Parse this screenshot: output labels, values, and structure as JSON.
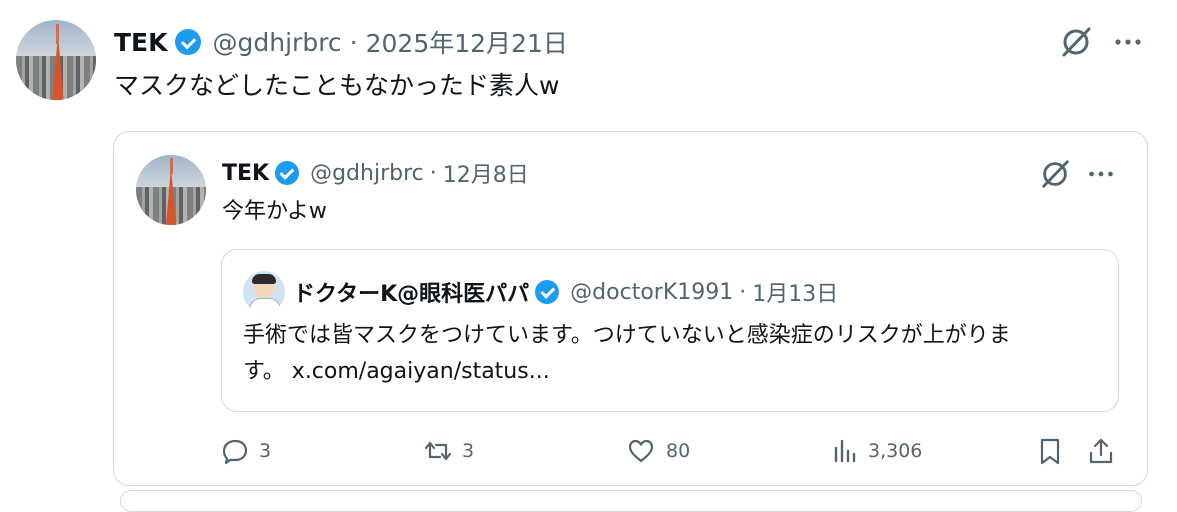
{
  "main_post": {
    "author_name": "TEK",
    "handle": "@gdhjrbrc",
    "separator": "·",
    "date": "2025年12月21日",
    "text": "マスクなどしたこともなかったド素人w"
  },
  "quoted_post": {
    "author_name": "TEK",
    "handle": "@gdhjrbrc",
    "separator": "·",
    "date": "12月8日",
    "text": "今年かよw",
    "stats": {
      "replies": "3",
      "reposts": "3",
      "likes": "80",
      "views": "3,306"
    }
  },
  "nested_quote": {
    "author_name": "ドクターK@眼科医パパ",
    "handle": "@doctorK1991",
    "separator": "·",
    "date": "1月13日",
    "text_line1": "手術では皆マスクをつけています。つけていないと感染症のリスクが上がりま",
    "text_line2": "す。 x.com/agaiyan/status..."
  },
  "colors": {
    "verified": "#1d9bf0",
    "muted": "#536471",
    "border": "#cfd9de"
  },
  "icons": [
    "grok-icon",
    "more-icon",
    "reply-icon",
    "repost-icon",
    "like-icon",
    "views-icon",
    "bookmark-icon",
    "share-icon"
  ]
}
